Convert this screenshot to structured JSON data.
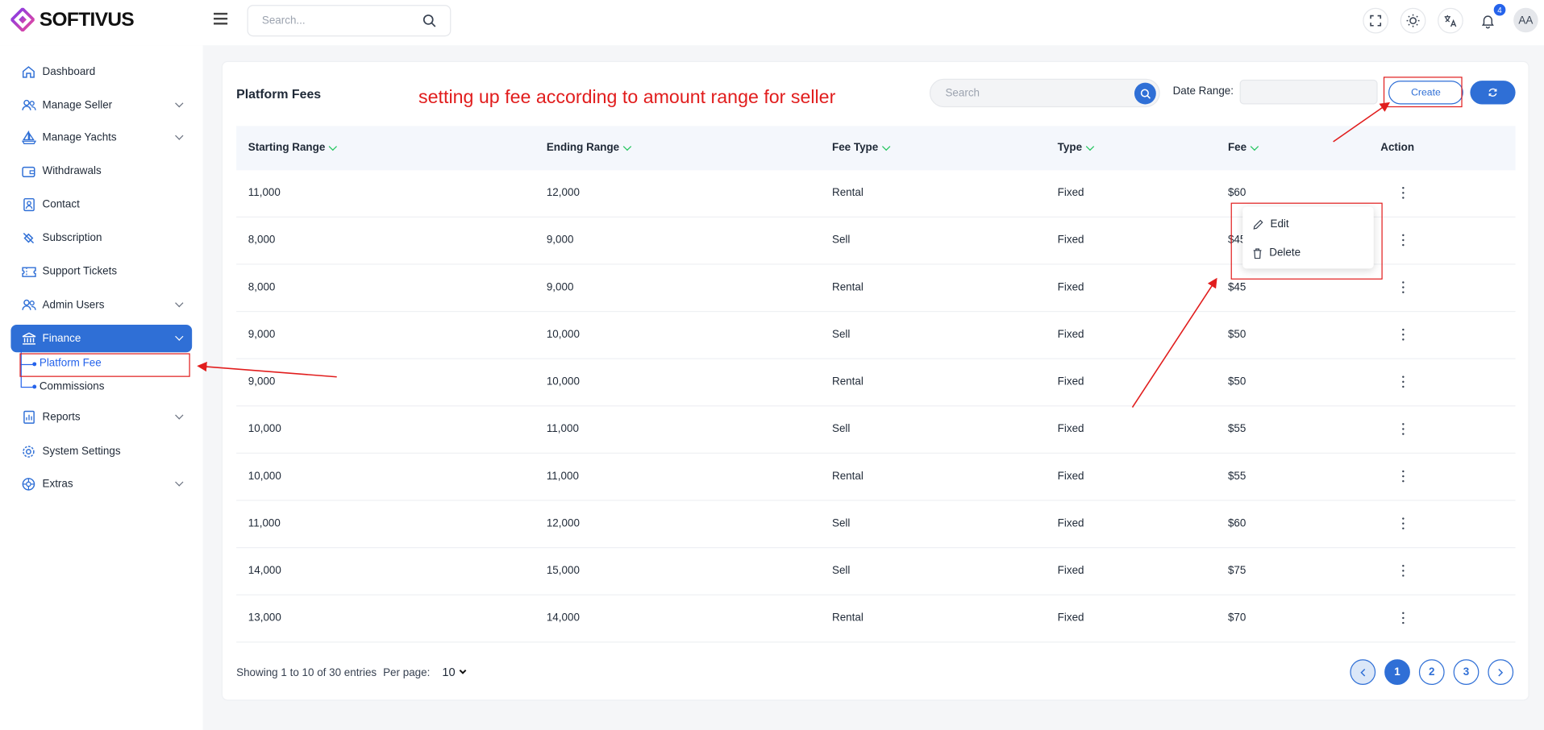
{
  "brand": {
    "name": "SOFTIVUS"
  },
  "topbar": {
    "search_placeholder": "Search...",
    "notification_count": "4",
    "avatar_initials": "AA"
  },
  "sidebar": {
    "items": [
      {
        "label": "Dashboard",
        "icon": "home-icon"
      },
      {
        "label": "Manage Seller",
        "icon": "users-icon"
      },
      {
        "label": "Manage Yachts",
        "icon": "sailboat-icon"
      },
      {
        "label": "Withdrawals",
        "icon": "wallet-icon"
      },
      {
        "label": "Contact",
        "icon": "contact-icon"
      },
      {
        "label": "Subscription",
        "icon": "subscription-icon"
      },
      {
        "label": "Support Tickets",
        "icon": "ticket-icon"
      },
      {
        "label": "Admin Users",
        "icon": "users-icon"
      },
      {
        "label": "Finance",
        "icon": "bank-icon"
      },
      {
        "label": "Reports",
        "icon": "report-icon"
      },
      {
        "label": "System Settings",
        "icon": "gear-icon"
      },
      {
        "label": "Extras",
        "icon": "extras-icon"
      }
    ],
    "finance_sub": [
      {
        "label": "Platform Fee"
      },
      {
        "label": "Commissions"
      }
    ]
  },
  "page": {
    "title": "Platform Fees",
    "annotation": "setting up fee according to amount range for seller",
    "search_placeholder": "Search",
    "date_range_label": "Date Range:",
    "create_label": "Create"
  },
  "table": {
    "columns": [
      "Starting Range",
      "Ending Range",
      "Fee Type",
      "Type",
      "Fee",
      "Action"
    ],
    "rows": [
      [
        "11,000",
        "12,000",
        "Rental",
        "Fixed",
        "$60"
      ],
      [
        "8,000",
        "9,000",
        "Sell",
        "Fixed",
        "$45"
      ],
      [
        "8,000",
        "9,000",
        "Rental",
        "Fixed",
        "$45"
      ],
      [
        "9,000",
        "10,000",
        "Sell",
        "Fixed",
        "$50"
      ],
      [
        "9,000",
        "10,000",
        "Rental",
        "Fixed",
        "$50"
      ],
      [
        "10,000",
        "11,000",
        "Sell",
        "Fixed",
        "$55"
      ],
      [
        "10,000",
        "11,000",
        "Rental",
        "Fixed",
        "$55"
      ],
      [
        "11,000",
        "12,000",
        "Sell",
        "Fixed",
        "$60"
      ],
      [
        "14,000",
        "15,000",
        "Sell",
        "Fixed",
        "$75"
      ],
      [
        "13,000",
        "14,000",
        "Rental",
        "Fixed",
        "$70"
      ]
    ]
  },
  "dropdown": {
    "edit_label": "Edit",
    "delete_label": "Delete"
  },
  "footer": {
    "showing": "Showing 1 to 10 of 30 entries",
    "per_page_label": "Per page:",
    "per_page_value": "10",
    "pages": [
      "1",
      "2",
      "3"
    ]
  },
  "colors": {
    "accent": "#2f6fd6",
    "annotation": "#e11d1d"
  }
}
